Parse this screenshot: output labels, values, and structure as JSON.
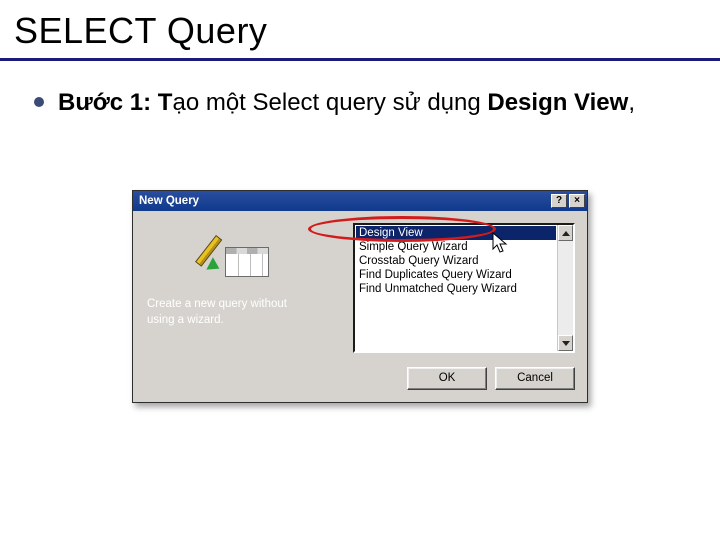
{
  "slide": {
    "title": "SELECT Query",
    "bullet_bold": "Bước 1: T",
    "bullet_rest": "ạo một Select query sử dụng ",
    "bullet_bold2": "Design View",
    "bullet_tail": ","
  },
  "dialog": {
    "title": "New Query",
    "help_glyph": "?",
    "close_glyph": "×",
    "left_text_line1": "Create a new query without",
    "left_text_line2": "using a wizard.",
    "items": [
      "Design View",
      "Simple Query Wizard",
      "Crosstab Query Wizard",
      "Find Duplicates Query Wizard",
      "Find Unmatched Query Wizard"
    ],
    "selected_index": 0,
    "ok_label": "OK",
    "cancel_label": "Cancel"
  },
  "icons": {
    "cursor": "arrow-cursor",
    "wizard": "pencil-grid-icon"
  }
}
